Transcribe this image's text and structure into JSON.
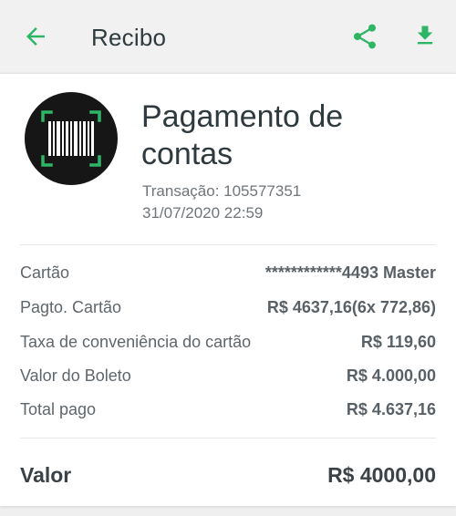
{
  "header": {
    "title": "Recibo",
    "back_icon": "arrow-left-icon",
    "share_icon": "share-icon",
    "download_icon": "download-icon",
    "accent_color": "#2eb565"
  },
  "receipt": {
    "logo_icon": "barcode-scan-icon",
    "title": "Pagamento de contas",
    "transaction_label": "Transação: 105577351",
    "datetime": "31/07/2020 22:59",
    "details": [
      {
        "label": "Cartão",
        "value": "************4493 Master"
      },
      {
        "label": "Pagto. Cartão",
        "value": "R$ 4637,16(6x 772,86)"
      },
      {
        "label": "Taxa de conveniência do cartão",
        "value": "R$ 119,60"
      },
      {
        "label": "Valor do Boleto",
        "value": "R$ 4.000,00"
      },
      {
        "label": "Total pago",
        "value": "R$ 4.637,16"
      }
    ],
    "total": {
      "label": "Valor",
      "value": "R$ 4000,00"
    }
  }
}
